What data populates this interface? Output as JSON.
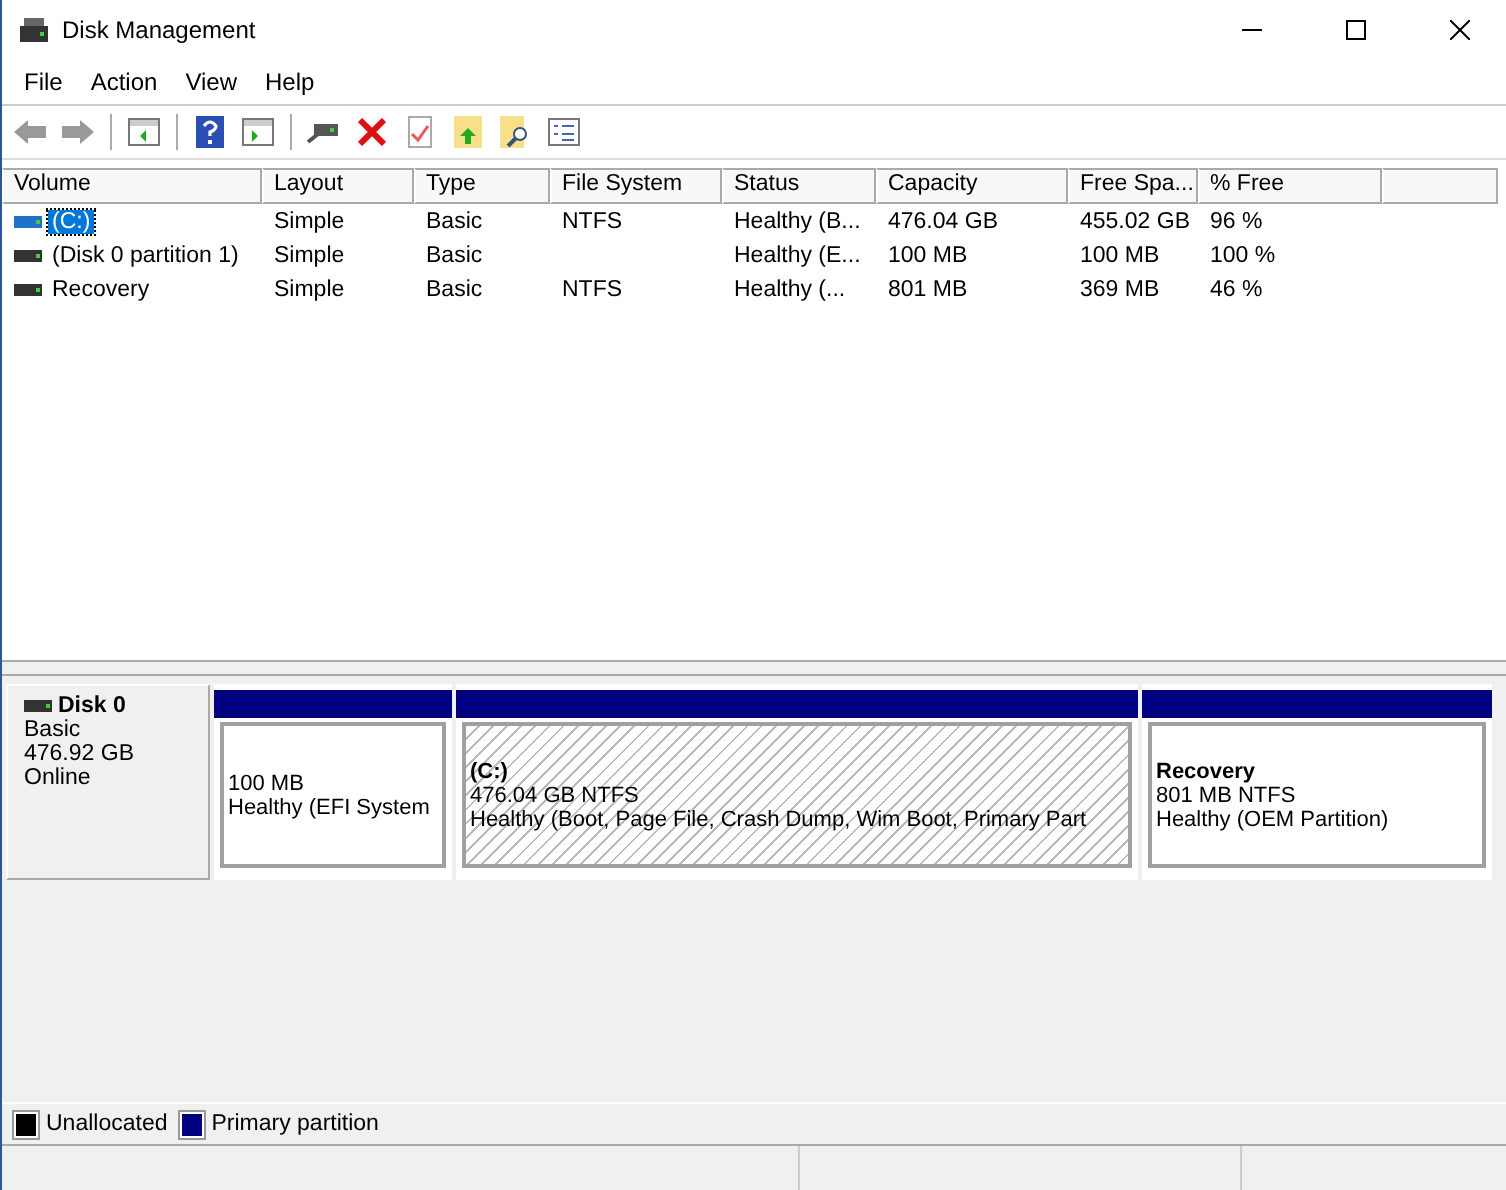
{
  "window": {
    "title": "Disk Management"
  },
  "menu": [
    "File",
    "Action",
    "View",
    "Help"
  ],
  "table": {
    "columns": [
      "Volume",
      "Layout",
      "Type",
      "File System",
      "Status",
      "Capacity",
      "Free Spa...",
      "% Free"
    ],
    "rows": [
      {
        "selected": true,
        "cells": [
          "(C:)",
          "Simple",
          "Basic",
          "NTFS",
          "Healthy (B...",
          "476.04 GB",
          "455.02 GB",
          "96 %"
        ]
      },
      {
        "selected": false,
        "cells": [
          "(Disk 0 partition 1)",
          "Simple",
          "Basic",
          "",
          "Healthy (E...",
          "100 MB",
          "100 MB",
          "100 %"
        ]
      },
      {
        "selected": false,
        "cells": [
          "Recovery",
          "Simple",
          "Basic",
          "NTFS",
          "Healthy (...",
          "801 MB",
          "369 MB",
          "46 %"
        ]
      }
    ]
  },
  "disk": {
    "name": "Disk 0",
    "type": "Basic",
    "size": "476.92 GB",
    "status": "Online",
    "partitions": [
      {
        "selected": false,
        "size": "100 MB",
        "status": "Healthy (EFI System"
      },
      {
        "selected": true,
        "name": "(C:)",
        "size": "476.04 GB NTFS",
        "status": "Healthy (Boot, Page File, Crash Dump, Wim Boot, Primary Part"
      },
      {
        "selected": false,
        "name": "Recovery",
        "size": "801 MB NTFS",
        "status": "Healthy (OEM Partition)"
      }
    ]
  },
  "legend": [
    {
      "label": "Unallocated",
      "color": "#000000"
    },
    {
      "label": "Primary partition",
      "color": "#000080"
    }
  ]
}
